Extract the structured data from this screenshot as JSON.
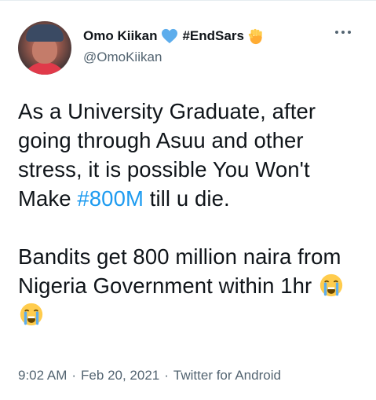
{
  "tweet": {
    "author": {
      "display_name": "Omo Kiikan",
      "hashtag": "#EndSars",
      "handle": "@OmoKiikan"
    },
    "text": {
      "line_part1": "As a University Graduate, after going through Asuu and other stress, it is possible You Won't Make ",
      "hashtag": "#800M",
      "line_part2": " till u die.",
      "para2": "Bandits get 800 million naira from Nigeria Government within 1hr"
    },
    "meta": {
      "time": "9:02 AM",
      "date": "Feb 20, 2021",
      "source": "Twitter for Android",
      "separator": "·"
    },
    "icons": {
      "heart": "blue-heart-icon",
      "fist": "raised-fist-icon",
      "crying": "loudly-crying-face-icon",
      "more": "more-options-icon"
    },
    "colors": {
      "link": "#1d9bf0",
      "heart": "#5dadec",
      "text": "#0f1419",
      "secondary": "#536471"
    }
  }
}
